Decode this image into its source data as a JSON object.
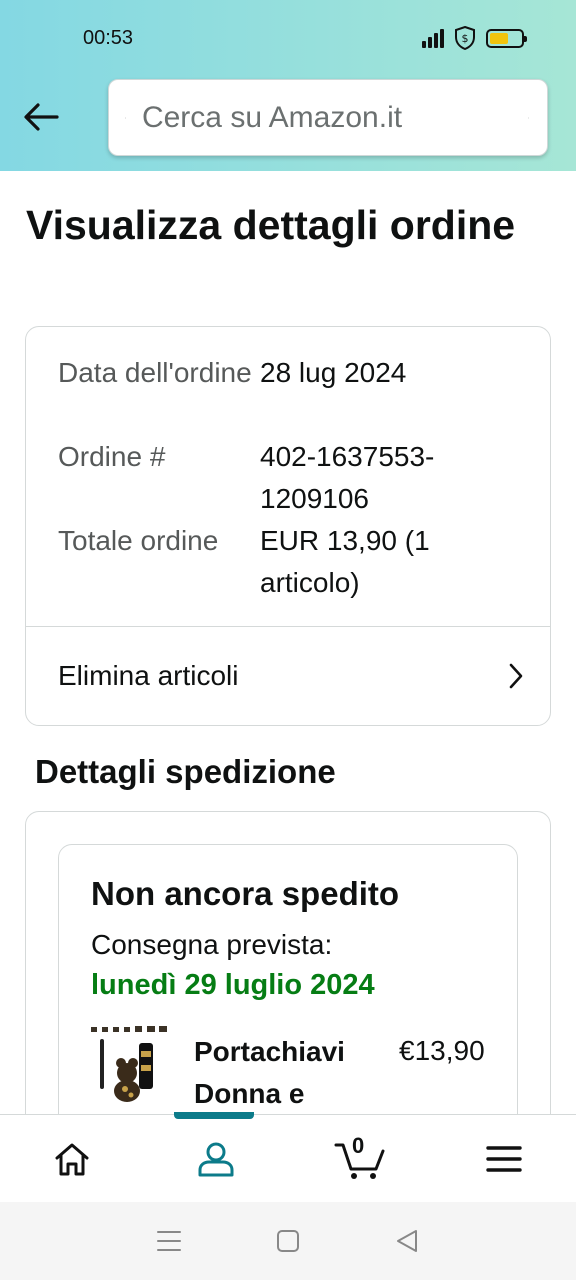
{
  "status_bar": {
    "time": "00:53",
    "battery_level": 0.6,
    "battery_color": "#f1c40f"
  },
  "header": {
    "search_placeholder": "Cerca su Amazon.it"
  },
  "page": {
    "title": "Visualizza dettagli ordine",
    "order_summary": [
      {
        "label": "Data dell'ordine",
        "value": "28 lug 2024"
      },
      {
        "label": "Ordine #",
        "value": "402-1637553-1209106"
      },
      {
        "label": "Totale ordine",
        "value": "EUR 13,90 (1 articolo)"
      }
    ],
    "manage_items_label": "Elimina articoli",
    "shipping_section_title": "Dettagli spedizione",
    "shipment": {
      "status": "Non ancora spedito",
      "expected_label": "Consegna prevista:",
      "expected_date": "lunedì 29 luglio 2024",
      "expected_date_color": "#067d14",
      "product_name": "Portachiavi Donna e",
      "product_price": "€13,90"
    }
  },
  "bottom_nav": {
    "items": [
      "home",
      "account",
      "cart",
      "menu"
    ],
    "active": "account",
    "cart_count": "0",
    "accent_color": "#0c7b8a"
  },
  "system_nav": [
    "recents",
    "home",
    "back"
  ]
}
